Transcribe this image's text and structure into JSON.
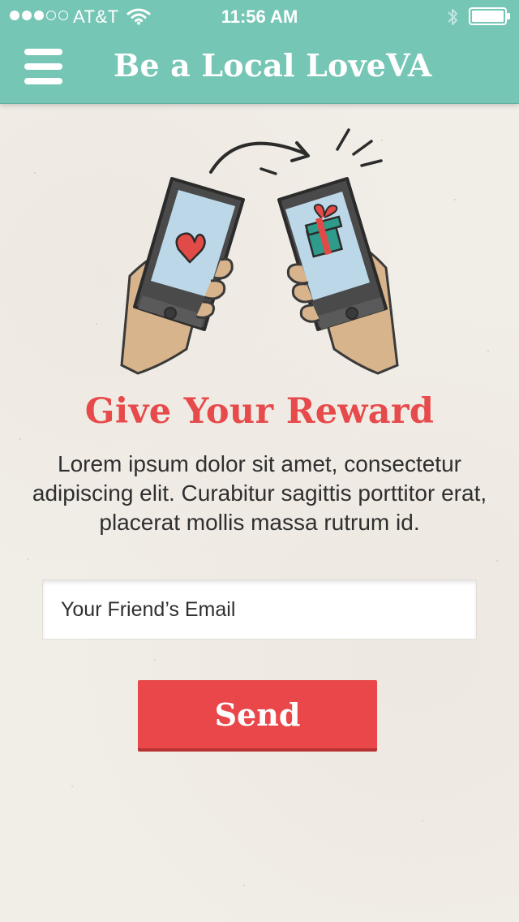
{
  "status_bar": {
    "carrier": "AT&T",
    "time": "11:56 AM",
    "signal_bars_filled": 3,
    "signal_bars_total": 5,
    "battery_level": 1.0
  },
  "nav": {
    "title": "Be a Local LoveVA",
    "menu_icon": "hamburger-menu-icon"
  },
  "illustration": {
    "icons": [
      "heart-icon",
      "gift-icon",
      "arrow-icon"
    ]
  },
  "content": {
    "heading": "Give Your Reward",
    "body": "Lorem ipsum dolor sit amet, consectetur adipiscing elit. Curabitur sagittis porttitor erat, placerat mollis massa rutrum id."
  },
  "form": {
    "email_placeholder": "Your Friend’s Email",
    "email_value": "",
    "send_label": "Send"
  },
  "colors": {
    "header": "#76c6b6",
    "accent_red": "#e64a4b",
    "button_red": "#e9474a",
    "background": "#f1ede7"
  }
}
